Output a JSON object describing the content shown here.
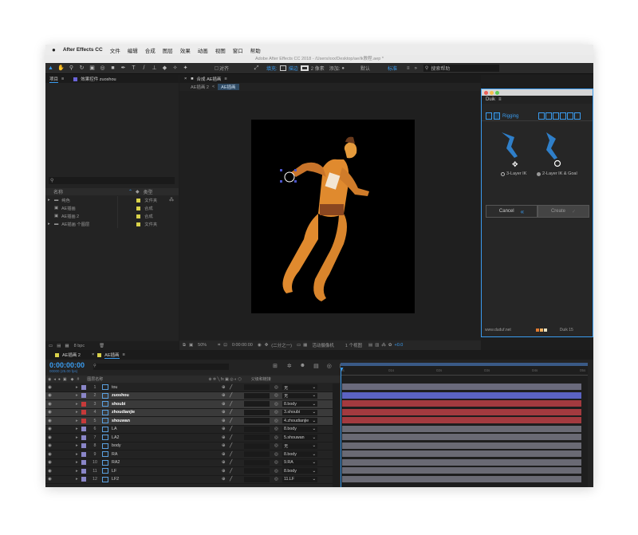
{
  "menubar": {
    "apple": "",
    "items": [
      "After Effects CC",
      "文件",
      "编辑",
      "合成",
      "图层",
      "效果",
      "动画",
      "视图",
      "窗口",
      "帮助"
    ]
  },
  "title": "Adobe After Effects CC 2018 - /Users/xxx/Desktop/ae/ik教程.aep *",
  "toolbar": {
    "snap": "对齐",
    "fill": "填充:",
    "stroke": "描边",
    "stroke_px": "2 像素",
    "add": "添加:",
    "workspace_default": "默认",
    "workspace_std": "标准",
    "search_placeholder": "搜索帮助"
  },
  "project": {
    "tab_project": "项目",
    "tab_effects": "效果控件 zuoshou",
    "search_placeholder": "",
    "col_name": "名称",
    "col_type": "类型",
    "items": [
      {
        "name": "纯色",
        "type": "文件夹",
        "color": "#d9d24a"
      },
      {
        "name": "AE插画",
        "type": "合成",
        "color": "#d9d24a"
      },
      {
        "name": "AE插画 2",
        "type": "合成",
        "color": "#d9d24a"
      },
      {
        "name": "AE插画 个图层",
        "type": "文件夹",
        "color": "#d9d24a"
      }
    ],
    "bpc": "8 bpc"
  },
  "comp": {
    "tab": "合成 AE插画",
    "breadcrumbs": [
      "AE插画 2",
      "AE插画"
    ],
    "zoom": "50%",
    "timecode": "0:00:00:00",
    "resolution": "(二分之一)",
    "camera": "活动摄像机",
    "views": "1 个视图",
    "exposure": "+0.0"
  },
  "duik": {
    "tab": "Duik",
    "rigging": "Rigging",
    "opt1": "3-Layer IK",
    "opt2": "2-Layer IK & Goal",
    "cancel": "Cancel",
    "create": "Create",
    "site": "www.duduf.net",
    "version": "Duik 15"
  },
  "timeline": {
    "tabs": [
      "AE插画 2",
      "AE插画"
    ],
    "timecode": "0:00:00:00",
    "fps": "00000 (25.00 fps)",
    "col_layer": "图层名称",
    "col_parent": "父级和链接",
    "layers": [
      {
        "num": "1",
        "name": "tou",
        "parent": "无",
        "label": "#8a86c8",
        "track": "#6a6a7c",
        "sel": false
      },
      {
        "num": "2",
        "name": "zuoshou",
        "parent": "无",
        "label": "#8a86c8",
        "track": "#5b63c2",
        "sel": true
      },
      {
        "num": "3",
        "name": "shoubi",
        "parent": "8.body",
        "label": "#c63a3a",
        "track": "#a33a3f",
        "sel": true
      },
      {
        "num": "4",
        "name": "zhoudianjie",
        "parent": "3.shoubi",
        "label": "#c63a3a",
        "track": "#a33a3f",
        "sel": true
      },
      {
        "num": "5",
        "name": "shouwan",
        "parent": "4.zhoudianjie",
        "label": "#c63a3a",
        "track": "#a33a3f",
        "sel": true
      },
      {
        "num": "6",
        "name": "LA",
        "parent": "8.body",
        "label": "#8a86c8",
        "track": "#6a6a74",
        "sel": false
      },
      {
        "num": "7",
        "name": "LA2",
        "parent": "5.shouwan",
        "label": "#8a86c8",
        "track": "#6a6a74",
        "sel": false
      },
      {
        "num": "8",
        "name": "body",
        "parent": "无",
        "label": "#8a86c8",
        "track": "#6a6a74",
        "sel": false
      },
      {
        "num": "9",
        "name": "RA",
        "parent": "8.body",
        "label": "#8a86c8",
        "track": "#6a6a74",
        "sel": false
      },
      {
        "num": "10",
        "name": "RA2",
        "parent": "9.RA",
        "label": "#8a86c8",
        "track": "#6a6a74",
        "sel": false
      },
      {
        "num": "11",
        "name": "LF",
        "parent": "8.body",
        "label": "#8a86c8",
        "track": "#6a6a74",
        "sel": false
      },
      {
        "num": "12",
        "name": "LF2",
        "parent": "11.LF",
        "label": "#8a86c8",
        "track": "#6a6a74",
        "sel": false
      }
    ],
    "ruler": [
      "0s",
      "01s",
      "02s",
      "03s",
      "04s",
      "05s"
    ]
  },
  "colors": {
    "accent": "#3a9cf0",
    "character": "#e08a2e"
  }
}
